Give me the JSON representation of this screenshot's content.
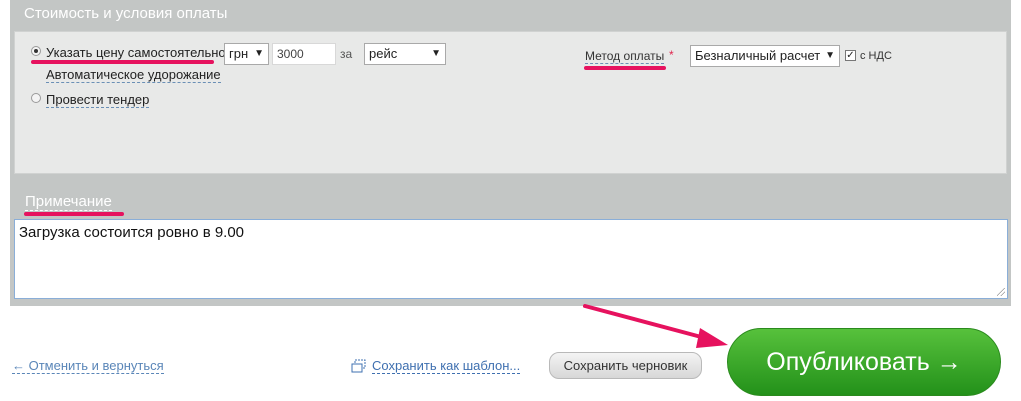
{
  "section": {
    "title": "Стоимость и условия оплаты"
  },
  "price_mode": {
    "options": [
      {
        "label": "Указать цену самостоятельно",
        "selected": true
      },
      {
        "label": "Автоматическое удорожание",
        "selected": false
      },
      {
        "label": "Провести тендер",
        "selected": false
      }
    ]
  },
  "price": {
    "currency": "грн",
    "amount": "3000",
    "per_label": "за",
    "unit": "рейс"
  },
  "payment": {
    "label": "Метод оплаты",
    "required_mark": "*",
    "method": "Безналичный расчет",
    "vat_checked": true,
    "vat_label": "с НДС"
  },
  "note": {
    "title": "Примечание",
    "value": "Загрузка состоится ровно в 9.00"
  },
  "actions": {
    "cancel_label": "← Отменить и вернуться",
    "save_template_label": "Сохранить как шаблон...",
    "save_draft_label": "Сохранить черновик",
    "publish_label": "Опубликовать →"
  },
  "colors": {
    "annotation": "#e6125e",
    "publish": "#3aaa2a",
    "panel": "#c3c6c5"
  },
  "icons": {
    "template": "template-copy-icon",
    "dropdown": "chevron-down-icon",
    "check": "check-icon"
  }
}
